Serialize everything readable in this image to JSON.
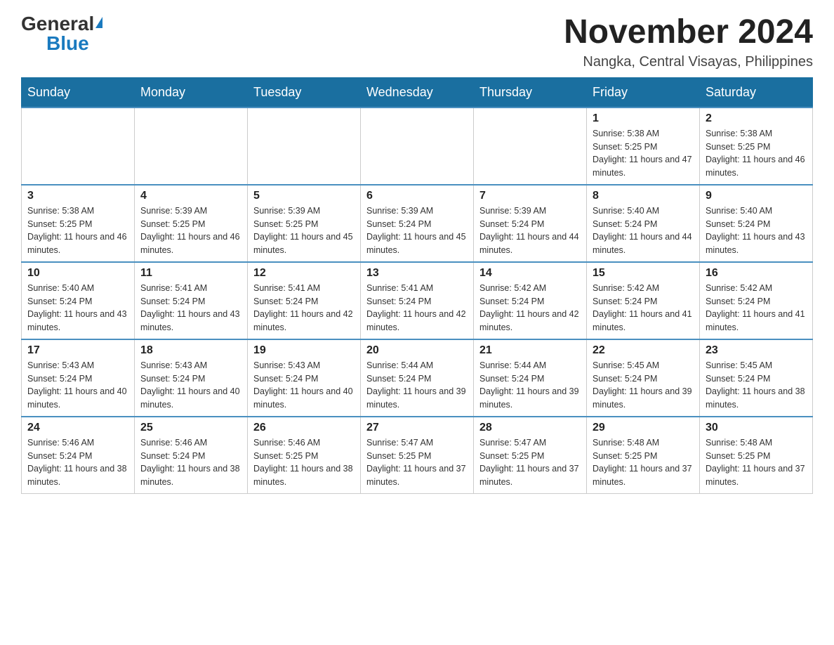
{
  "header": {
    "logo_text1": "General",
    "logo_text2": "Blue",
    "title": "November 2024",
    "subtitle": "Nangka, Central Visayas, Philippines"
  },
  "days_of_week": [
    "Sunday",
    "Monday",
    "Tuesday",
    "Wednesday",
    "Thursday",
    "Friday",
    "Saturday"
  ],
  "weeks": [
    [
      {
        "day": "",
        "info": ""
      },
      {
        "day": "",
        "info": ""
      },
      {
        "day": "",
        "info": ""
      },
      {
        "day": "",
        "info": ""
      },
      {
        "day": "",
        "info": ""
      },
      {
        "day": "1",
        "info": "Sunrise: 5:38 AM\nSunset: 5:25 PM\nDaylight: 11 hours and 47 minutes."
      },
      {
        "day": "2",
        "info": "Sunrise: 5:38 AM\nSunset: 5:25 PM\nDaylight: 11 hours and 46 minutes."
      }
    ],
    [
      {
        "day": "3",
        "info": "Sunrise: 5:38 AM\nSunset: 5:25 PM\nDaylight: 11 hours and 46 minutes."
      },
      {
        "day": "4",
        "info": "Sunrise: 5:39 AM\nSunset: 5:25 PM\nDaylight: 11 hours and 46 minutes."
      },
      {
        "day": "5",
        "info": "Sunrise: 5:39 AM\nSunset: 5:25 PM\nDaylight: 11 hours and 45 minutes."
      },
      {
        "day": "6",
        "info": "Sunrise: 5:39 AM\nSunset: 5:24 PM\nDaylight: 11 hours and 45 minutes."
      },
      {
        "day": "7",
        "info": "Sunrise: 5:39 AM\nSunset: 5:24 PM\nDaylight: 11 hours and 44 minutes."
      },
      {
        "day": "8",
        "info": "Sunrise: 5:40 AM\nSunset: 5:24 PM\nDaylight: 11 hours and 44 minutes."
      },
      {
        "day": "9",
        "info": "Sunrise: 5:40 AM\nSunset: 5:24 PM\nDaylight: 11 hours and 43 minutes."
      }
    ],
    [
      {
        "day": "10",
        "info": "Sunrise: 5:40 AM\nSunset: 5:24 PM\nDaylight: 11 hours and 43 minutes."
      },
      {
        "day": "11",
        "info": "Sunrise: 5:41 AM\nSunset: 5:24 PM\nDaylight: 11 hours and 43 minutes."
      },
      {
        "day": "12",
        "info": "Sunrise: 5:41 AM\nSunset: 5:24 PM\nDaylight: 11 hours and 42 minutes."
      },
      {
        "day": "13",
        "info": "Sunrise: 5:41 AM\nSunset: 5:24 PM\nDaylight: 11 hours and 42 minutes."
      },
      {
        "day": "14",
        "info": "Sunrise: 5:42 AM\nSunset: 5:24 PM\nDaylight: 11 hours and 42 minutes."
      },
      {
        "day": "15",
        "info": "Sunrise: 5:42 AM\nSunset: 5:24 PM\nDaylight: 11 hours and 41 minutes."
      },
      {
        "day": "16",
        "info": "Sunrise: 5:42 AM\nSunset: 5:24 PM\nDaylight: 11 hours and 41 minutes."
      }
    ],
    [
      {
        "day": "17",
        "info": "Sunrise: 5:43 AM\nSunset: 5:24 PM\nDaylight: 11 hours and 40 minutes."
      },
      {
        "day": "18",
        "info": "Sunrise: 5:43 AM\nSunset: 5:24 PM\nDaylight: 11 hours and 40 minutes."
      },
      {
        "day": "19",
        "info": "Sunrise: 5:43 AM\nSunset: 5:24 PM\nDaylight: 11 hours and 40 minutes."
      },
      {
        "day": "20",
        "info": "Sunrise: 5:44 AM\nSunset: 5:24 PM\nDaylight: 11 hours and 39 minutes."
      },
      {
        "day": "21",
        "info": "Sunrise: 5:44 AM\nSunset: 5:24 PM\nDaylight: 11 hours and 39 minutes."
      },
      {
        "day": "22",
        "info": "Sunrise: 5:45 AM\nSunset: 5:24 PM\nDaylight: 11 hours and 39 minutes."
      },
      {
        "day": "23",
        "info": "Sunrise: 5:45 AM\nSunset: 5:24 PM\nDaylight: 11 hours and 38 minutes."
      }
    ],
    [
      {
        "day": "24",
        "info": "Sunrise: 5:46 AM\nSunset: 5:24 PM\nDaylight: 11 hours and 38 minutes."
      },
      {
        "day": "25",
        "info": "Sunrise: 5:46 AM\nSunset: 5:24 PM\nDaylight: 11 hours and 38 minutes."
      },
      {
        "day": "26",
        "info": "Sunrise: 5:46 AM\nSunset: 5:25 PM\nDaylight: 11 hours and 38 minutes."
      },
      {
        "day": "27",
        "info": "Sunrise: 5:47 AM\nSunset: 5:25 PM\nDaylight: 11 hours and 37 minutes."
      },
      {
        "day": "28",
        "info": "Sunrise: 5:47 AM\nSunset: 5:25 PM\nDaylight: 11 hours and 37 minutes."
      },
      {
        "day": "29",
        "info": "Sunrise: 5:48 AM\nSunset: 5:25 PM\nDaylight: 11 hours and 37 minutes."
      },
      {
        "day": "30",
        "info": "Sunrise: 5:48 AM\nSunset: 5:25 PM\nDaylight: 11 hours and 37 minutes."
      }
    ]
  ]
}
